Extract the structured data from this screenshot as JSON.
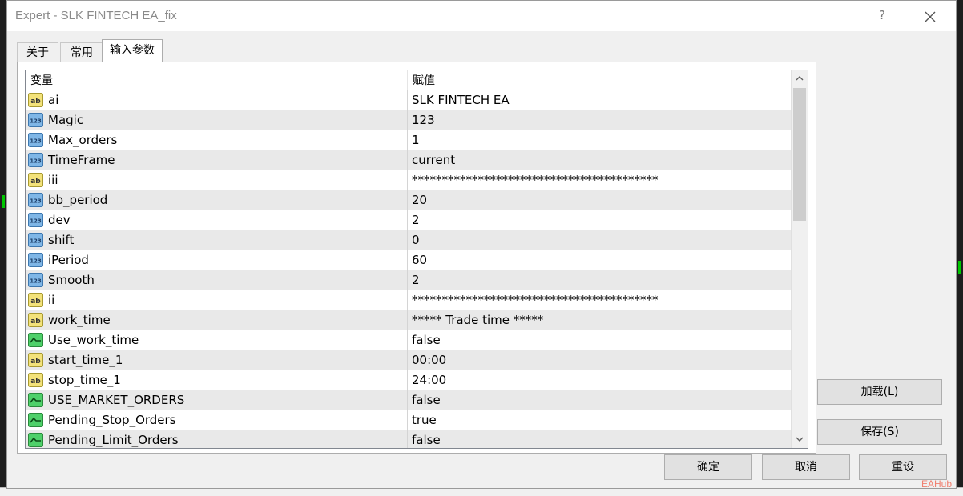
{
  "window": {
    "title": "Expert - SLK FINTECH EA_fix",
    "help_symbol": "?"
  },
  "tabs": [
    {
      "label": "关于"
    },
    {
      "label": "常用"
    },
    {
      "label": "输入参数"
    }
  ],
  "grid": {
    "headers": {
      "variable": "变量",
      "value": "赋值"
    },
    "rows": [
      {
        "type": "ab",
        "name": "ai",
        "value": "SLK FINTECH EA"
      },
      {
        "type": "123",
        "name": "Magic",
        "value": "123"
      },
      {
        "type": "123",
        "name": "Max_orders",
        "value": "1"
      },
      {
        "type": "123",
        "name": "TimeFrame",
        "value": "current"
      },
      {
        "type": "ab",
        "name": "iii",
        "value": "*****************************************"
      },
      {
        "type": "123",
        "name": "bb_period",
        "value": "20"
      },
      {
        "type": "123",
        "name": "dev",
        "value": "2"
      },
      {
        "type": "123",
        "name": "shift",
        "value": "0"
      },
      {
        "type": "123",
        "name": "iPeriod",
        "value": "60"
      },
      {
        "type": "123",
        "name": "Smooth",
        "value": "2"
      },
      {
        "type": "ab",
        "name": "ii",
        "value": "*****************************************"
      },
      {
        "type": "ab",
        "name": "work_time",
        "value": "***** Trade time *****"
      },
      {
        "type": "bool",
        "name": "Use_work_time",
        "value": "false"
      },
      {
        "type": "ab",
        "name": "start_time_1",
        "value": "00:00"
      },
      {
        "type": "ab",
        "name": "stop_time_1",
        "value": "24:00"
      },
      {
        "type": "bool",
        "name": "USE_MARKET_ORDERS",
        "value": "false"
      },
      {
        "type": "bool",
        "name": "Pending_Stop_Orders",
        "value": "true"
      },
      {
        "type": "bool",
        "name": "Pending_Limit_Orders",
        "value": "false"
      }
    ]
  },
  "side_buttons": {
    "load": "加载(L)",
    "save": "保存(S)"
  },
  "footer_buttons": {
    "ok": "确定",
    "cancel": "取消",
    "reset": "重设"
  },
  "watermark": "EAHub",
  "colors": {
    "ab_icon": "#f3e27a",
    "num_icon": "#7fb6e6",
    "bool_icon": "#4fd06a"
  }
}
